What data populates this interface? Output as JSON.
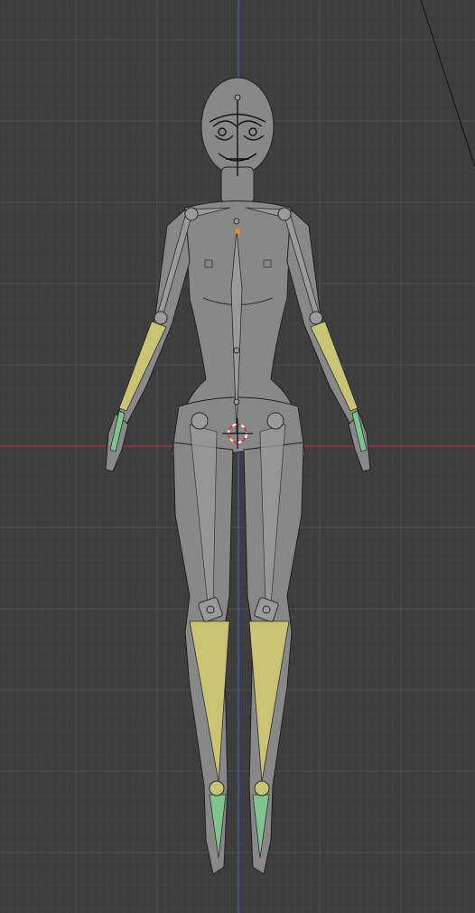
{
  "viewport": {
    "view": "front-orthographic",
    "mode": "pose",
    "grid_visible": true,
    "grid_step_major_units": 10,
    "background_color": "#3d3d3d",
    "grid_minor_color": "#464646",
    "grid_major_color": "#505050",
    "x_axis_color": "#b0343d",
    "z_axis_color": "#3a66b8"
  },
  "character": {
    "body_color": "#8d8d8d",
    "bone_color": "#9a9a9a",
    "bone_selected_color": "#c8c474",
    "bone_active_color": "#7fc48d",
    "outline_color": "#1a1a1a"
  },
  "cursor_3d": {
    "icon": "3d-cursor-icon"
  }
}
